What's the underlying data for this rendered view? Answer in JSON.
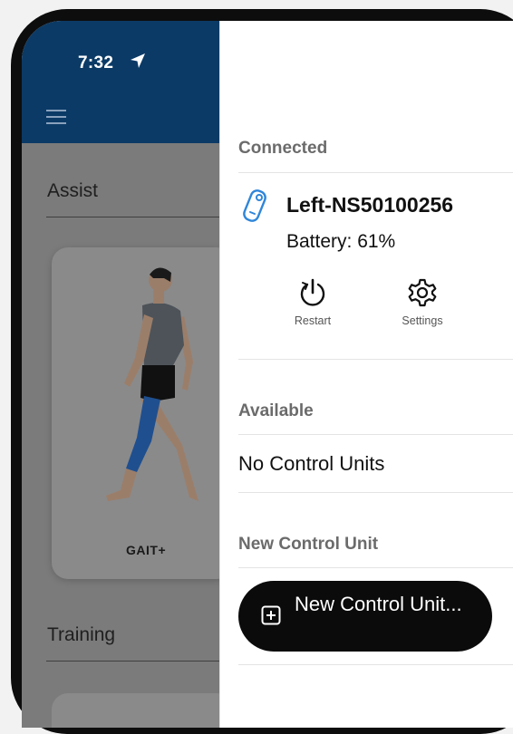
{
  "status_bar": {
    "time": "7:32",
    "location_icon": "location-arrow-icon"
  },
  "app": {
    "menu_icon": "hamburger-menu-icon",
    "sections": [
      {
        "title": "Assist",
        "card_label": "GAIT+"
      },
      {
        "title": "Training"
      }
    ]
  },
  "drawer": {
    "connected": {
      "header": "Connected",
      "device_icon": "control-unit-icon",
      "device_name": "Left-NS50100256",
      "battery": "Battery: 61%",
      "actions": [
        {
          "label": "Restart",
          "icon": "restart-icon"
        },
        {
          "label": "Settings",
          "icon": "gear-icon"
        }
      ]
    },
    "available": {
      "header": "Available",
      "empty_text": "No Control Units"
    },
    "new_unit": {
      "header": "New Control Unit",
      "button_label": "New Control Unit...",
      "button_icon": "plus-square-icon"
    }
  },
  "colors": {
    "header_blue": "#0b3a66",
    "overlay_gray": "#7b7b7b",
    "button_black": "#0b0b0b",
    "device_icon_blue": "#2f86d9"
  }
}
